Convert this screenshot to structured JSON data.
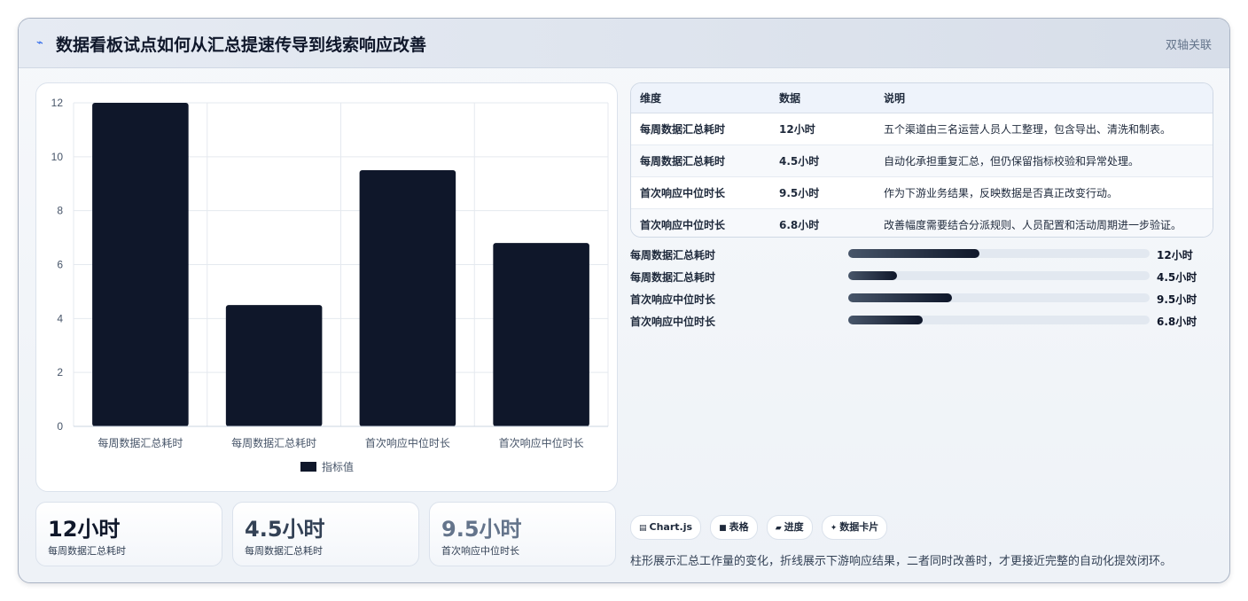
{
  "header": {
    "title": "数据看板试点如何从汇总提速传导到线索响应改善",
    "badge": "双轴关联",
    "icon": "trend-icon"
  },
  "chart_data": {
    "type": "bar",
    "categories": [
      "每周数据汇总耗时",
      "每周数据汇总耗时",
      "首次响应中位时长",
      "首次响应中位时长"
    ],
    "series": [
      {
        "name": "指标值",
        "values": [
          12,
          4.5,
          9.5,
          6.8
        ],
        "color": "#0f172a"
      }
    ],
    "ylim": [
      0,
      12
    ],
    "yticks": [
      0,
      2,
      4,
      6,
      8,
      10,
      12
    ],
    "grid": true,
    "legend": "bottom"
  },
  "kpis": [
    {
      "value": "12小时",
      "label": "每周数据汇总耗时",
      "color": "#0f172a"
    },
    {
      "value": "4.5小时",
      "label": "每周数据汇总耗时",
      "color": "#334155"
    },
    {
      "value": "9.5小时",
      "label": "首次响应中位时长",
      "color": "#64748b"
    }
  ],
  "table": {
    "headers": [
      "维度",
      "数据",
      "说明"
    ],
    "rows": [
      [
        "每周数据汇总耗时",
        "12小时",
        "五个渠道由三名运营人员人工整理，包含导出、清洗和制表。"
      ],
      [
        "每周数据汇总耗时",
        "4.5小时",
        "自动化承担重复汇总，但仍保留指标校验和异常处理。"
      ],
      [
        "首次响应中位时长",
        "9.5小时",
        "作为下游业务结果，反映数据是否真正改变行动。"
      ],
      [
        "首次响应中位时长",
        "6.8小时",
        "改善幅度需要结合分派规则、人员配置和活动周期进一步验证。"
      ]
    ]
  },
  "progress": [
    {
      "label": "每周数据汇总耗时",
      "value": "12小时",
      "fraction": 0.435
    },
    {
      "label": "每周数据汇总耗时",
      "value": "4.5小时",
      "fraction": 0.163
    },
    {
      "label": "首次响应中位时长",
      "value": "9.5小时",
      "fraction": 0.344
    },
    {
      "label": "首次响应中位时长",
      "value": "6.8小时",
      "fraction": 0.246
    }
  ],
  "tags": [
    {
      "icon": "▤",
      "label": "Chart.js"
    },
    {
      "icon": "■",
      "label": "表格"
    },
    {
      "icon": "▰",
      "label": "进度"
    },
    {
      "icon": "✦",
      "label": "数据卡片"
    }
  ],
  "note": "柱形展示汇总工作量的变化，折线展示下游响应结果，二者同时改善时，才更接近完整的自动化提效闭环。"
}
